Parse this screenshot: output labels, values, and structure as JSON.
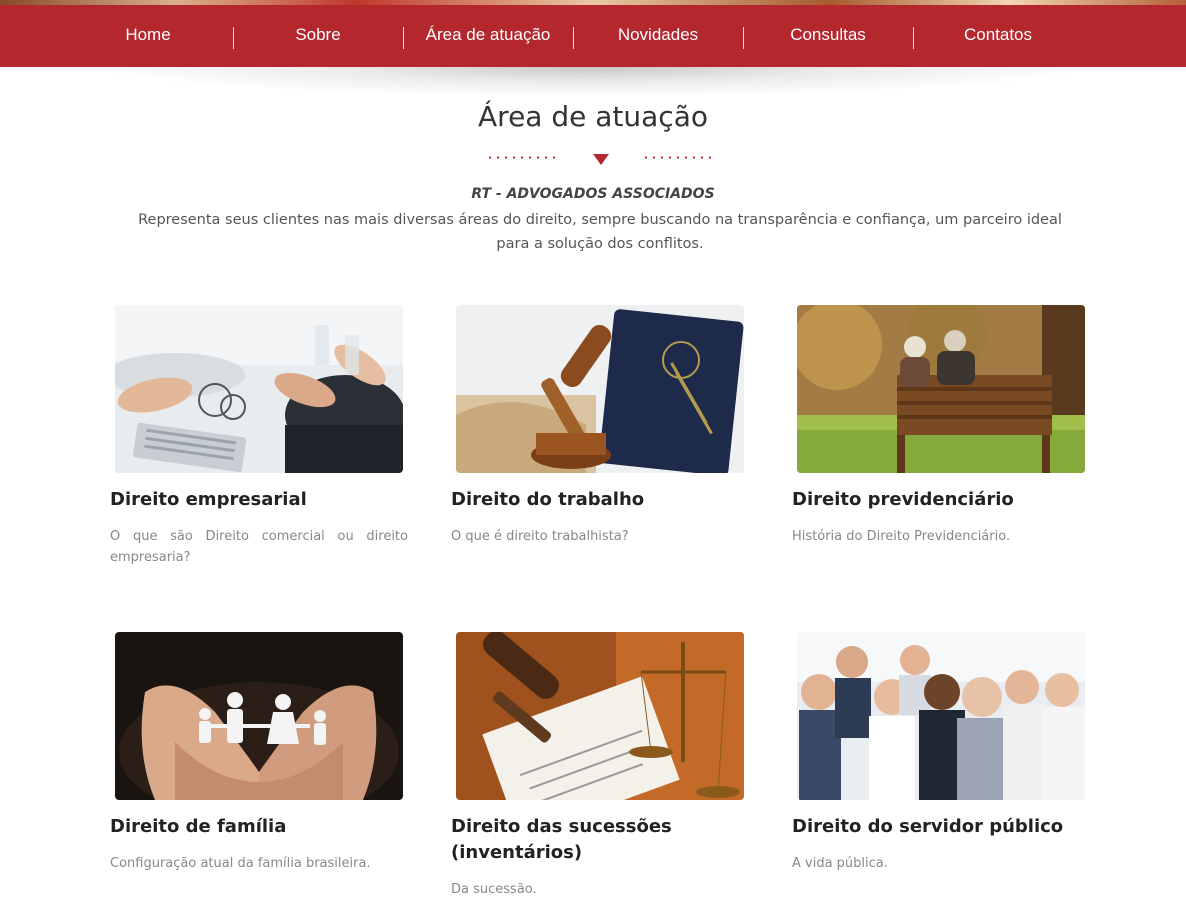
{
  "nav": {
    "items": [
      {
        "label": "Home"
      },
      {
        "label": "Sobre"
      },
      {
        "label": "Área de atuação"
      },
      {
        "label": "Novidades"
      },
      {
        "label": "Consultas"
      },
      {
        "label": "Contatos"
      }
    ]
  },
  "section": {
    "title": "Área de atuação",
    "firm_name": "RT - ADVOGADOS ASSOCIADOS",
    "intro": "Representa seus clientes nas mais diversas áreas do direito, sempre buscando na transparência e confiança, um parceiro ideal para a solução dos conflitos."
  },
  "cards": [
    {
      "title": "Direito empresarial",
      "desc": "O que são Direito comercial ou direito empresaria?"
    },
    {
      "title": "Direito do trabalho",
      "desc": "O que é direito trabalhista?"
    },
    {
      "title": "Direito previdenciário",
      "desc": "História do Direito Previdenciário."
    },
    {
      "title": "Direito de família",
      "desc": "Configuração atual da família brasileira."
    },
    {
      "title": "Direito das sucessões (inventários)",
      "desc": "Da sucessão."
    },
    {
      "title": "Direito do servidor público",
      "desc": "A vida pública."
    }
  ],
  "colors": {
    "brand_red": "#b3272d",
    "nav_text": "#ffffff"
  }
}
